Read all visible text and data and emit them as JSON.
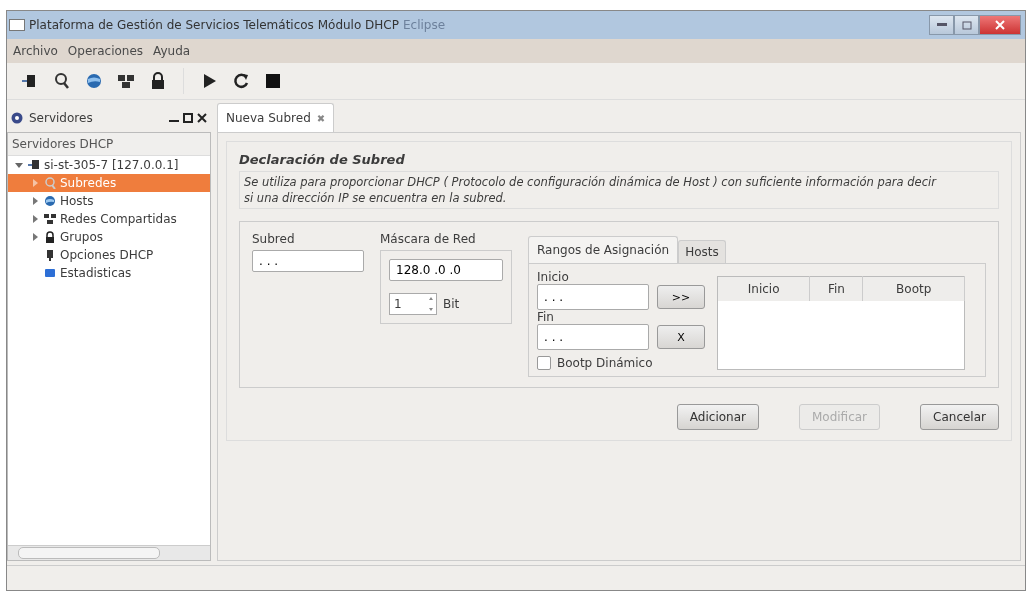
{
  "window": {
    "title": "Plataforma de Gestión de Servicios Telemáticos Módulo DHCP",
    "app_name": "Eclipse"
  },
  "menu": [
    "Archivo",
    "Operaciones",
    "Ayuda"
  ],
  "sidebar": {
    "title": "Servidores",
    "header": "Servidores DHCP",
    "tree": [
      {
        "label": "si-st-305-7 [127.0.0.1]",
        "expanded": true,
        "selected": false,
        "children": [
          {
            "label": "Subredes",
            "kind": "branch",
            "selected": true
          },
          {
            "label": "Hosts",
            "kind": "branch",
            "selected": false
          },
          {
            "label": "Redes Compartidas",
            "kind": "branch",
            "selected": false
          },
          {
            "label": "Grupos",
            "kind": "branch",
            "selected": false
          },
          {
            "label": "Opciones DHCP",
            "kind": "leaf",
            "selected": false
          },
          {
            "label": "Estadisticas",
            "kind": "leaf",
            "selected": false
          }
        ]
      }
    ]
  },
  "editor_tab": {
    "label": "Nueva Subred",
    "close": "✖"
  },
  "form": {
    "title": "Declaración de Subred",
    "description": "Se utiliza para proporcionar DHCP ( Protocolo de configuración dinámica de Host ) con suficiente información para decir si  una dirección IP se encuentra en la subred.",
    "subnet": {
      "label": "Subred",
      "value": ". . ."
    },
    "mask": {
      "label": "Máscara de Red",
      "value": "128.0 .0 .0",
      "bits": "1",
      "bits_label": "Bit"
    },
    "tabs": [
      {
        "label": "Rangos de Asignación",
        "selected": true
      },
      {
        "label": "Hosts",
        "selected": false
      }
    ],
    "start": {
      "label": "Inicio",
      "value": ". . ."
    },
    "end": {
      "label": "Fin",
      "value": ". . ."
    },
    "add_range": ">>",
    "remove_range": "X",
    "bootp": {
      "label": "Bootp Dinámico",
      "checked": false
    },
    "table": {
      "columns": [
        "Inicio",
        "Fin",
        "Bootp"
      ]
    },
    "buttons": [
      {
        "label": "Adicionar",
        "disabled": false
      },
      {
        "label": "Modificar",
        "disabled": true
      },
      {
        "label": "Cancelar",
        "disabled": false
      }
    ]
  }
}
